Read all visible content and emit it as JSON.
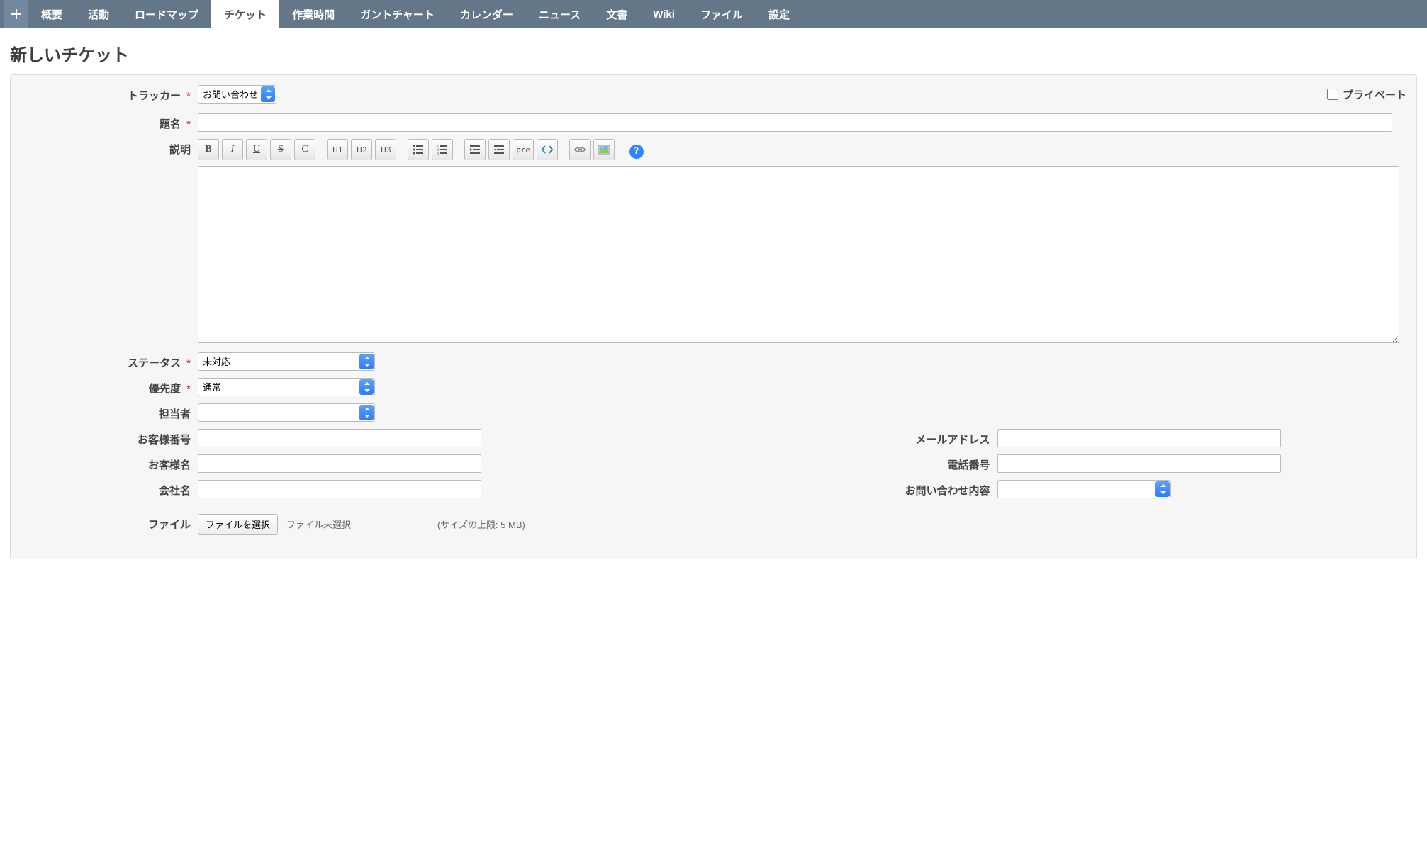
{
  "nav": {
    "items": [
      {
        "label": "概要"
      },
      {
        "label": "活動"
      },
      {
        "label": "ロードマップ"
      },
      {
        "label": "チケット",
        "active": true
      },
      {
        "label": "作業時間"
      },
      {
        "label": "ガントチャート"
      },
      {
        "label": "カレンダー"
      },
      {
        "label": "ニュース"
      },
      {
        "label": "文書"
      },
      {
        "label": "Wiki"
      },
      {
        "label": "ファイル"
      },
      {
        "label": "設定"
      }
    ]
  },
  "page": {
    "title": "新しいチケット"
  },
  "form": {
    "tracker_label": "トラッカー",
    "tracker_value": "お問い合わせ",
    "private_label": "プライベート",
    "subject_label": "題名",
    "subject_value": "",
    "description_label": "説明",
    "description_value": "",
    "status_label": "ステータス",
    "status_value": "未対応",
    "priority_label": "優先度",
    "priority_value": "通常",
    "assignee_label": "担当者",
    "assignee_value": "",
    "customer_no_label": "お客様番号",
    "customer_no_value": "",
    "customer_name_label": "お客様名",
    "customer_name_value": "",
    "company_label": "会社名",
    "company_value": "",
    "email_label": "メールアドレス",
    "email_value": "",
    "phone_label": "電話番号",
    "phone_value": "",
    "inquiry_label": "お問い合わせ内容",
    "inquiry_value": "",
    "file_label": "ファイル",
    "file_button": "ファイルを選択",
    "file_status": "ファイル未選択",
    "file_hint": "(サイズの上限: 5 MB)"
  },
  "toolbar": {
    "bold": "B",
    "italic": "I",
    "underline": "U",
    "strike": "S",
    "code": "C",
    "h1": "H1",
    "h2": "H2",
    "h3": "H3",
    "pre": "pre"
  }
}
